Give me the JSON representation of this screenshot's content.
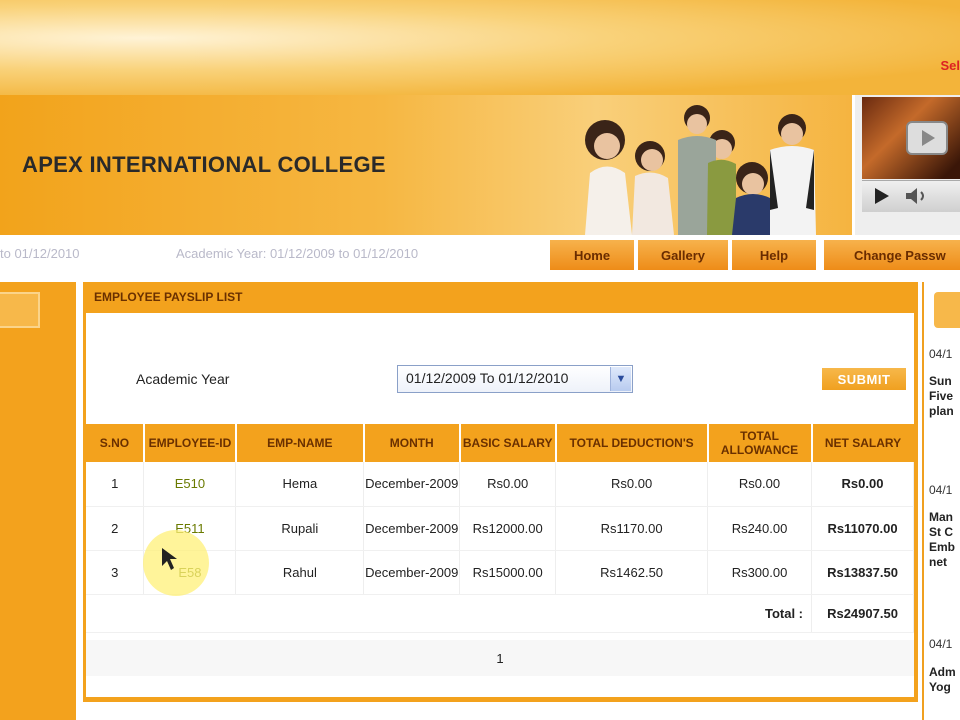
{
  "header": {
    "select_text": "Sel",
    "college_name": "APEX INTERNATIONAL COLLEGE"
  },
  "info": {
    "date_range": "to 01/12/2010",
    "academic_year": "Academic Year: 01/12/2009 to 01/12/2010"
  },
  "nav": {
    "home": "Home",
    "gallery": "Gallery",
    "help": "Help",
    "change_password": "Change Passw"
  },
  "main": {
    "title": "EMPLOYEE PAYSLIP LIST",
    "academic_year_label": "Academic Year",
    "academic_year_value": "01/12/2009 To 01/12/2010",
    "submit_label": "SUBMIT",
    "columns": [
      "S.NO",
      "EMPLOYEE-ID",
      "EMP-NAME",
      "MONTH",
      "BASIC SALARY",
      "TOTAL DEDUCTION'S",
      "TOTAL ALLOWANCE",
      "NET SALARY"
    ],
    "rows": [
      {
        "sno": "1",
        "eid": "E510",
        "name": "Hema",
        "month": "December-2009",
        "basic": "Rs0.00",
        "deduction": "Rs0.00",
        "allowance": "Rs0.00",
        "net": "Rs0.00"
      },
      {
        "sno": "2",
        "eid": "E511",
        "name": "Rupali",
        "month": "December-2009",
        "basic": "Rs12000.00",
        "deduction": "Rs1170.00",
        "allowance": "Rs240.00",
        "net": "Rs11070.00"
      },
      {
        "sno": "3",
        "eid": "E58",
        "name": "Rahul",
        "month": "December-2009",
        "basic": "Rs15000.00",
        "deduction": "Rs1462.50",
        "allowance": "Rs300.00",
        "net": "Rs13837.50"
      }
    ],
    "total_label": "Total :",
    "total_value": "Rs24907.50",
    "page": "1"
  },
  "right": {
    "items": [
      {
        "date": "04/1",
        "text": "Sun\nFive\nplan"
      },
      {
        "date": "04/1",
        "text": "Man\nSt C\nEmb\nnet"
      },
      {
        "date": "04/1",
        "text": "Adm\nYog"
      }
    ]
  },
  "colors": {
    "accent": "#f3a21d",
    "header_text": "#6a3000"
  }
}
